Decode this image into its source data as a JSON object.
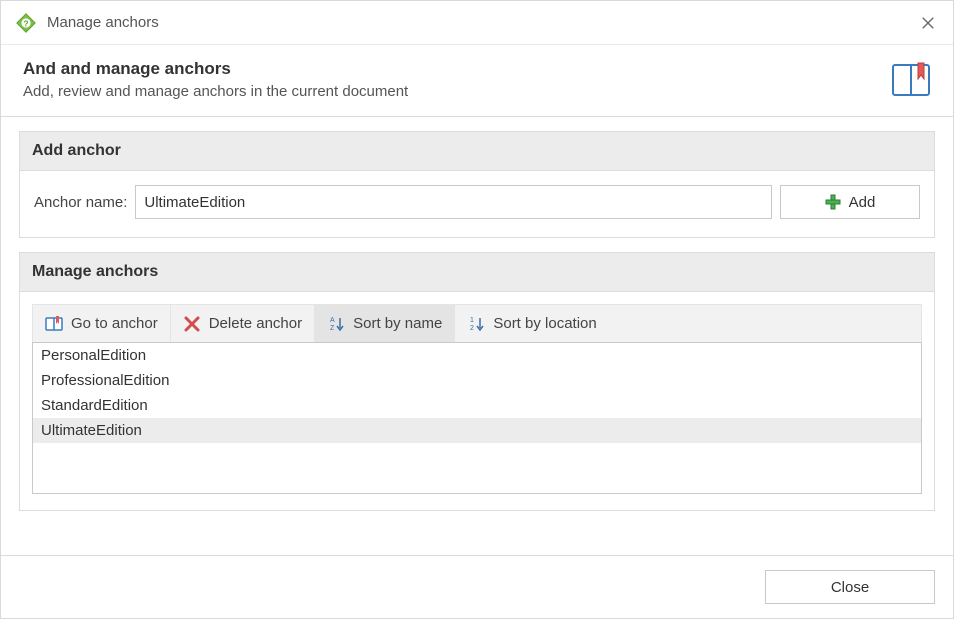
{
  "titlebar": {
    "title": "Manage anchors"
  },
  "header": {
    "title": "And and manage anchors",
    "subtitle": "Add, review and manage anchors in the current document"
  },
  "add_section": {
    "group_title": "Add anchor",
    "label": "Anchor name:",
    "value": "UltimateEdition",
    "add_button": "Add"
  },
  "manage_section": {
    "group_title": "Manage anchors",
    "toolbar": {
      "goto": "Go to anchor",
      "delete": "Delete anchor",
      "sort_name": "Sort by name",
      "sort_location": "Sort by location"
    },
    "items": [
      {
        "label": "PersonalEdition",
        "selected": false
      },
      {
        "label": "ProfessionalEdition",
        "selected": false
      },
      {
        "label": "StandardEdition",
        "selected": false
      },
      {
        "label": "UltimateEdition",
        "selected": true
      }
    ]
  },
  "footer": {
    "close": "Close"
  }
}
